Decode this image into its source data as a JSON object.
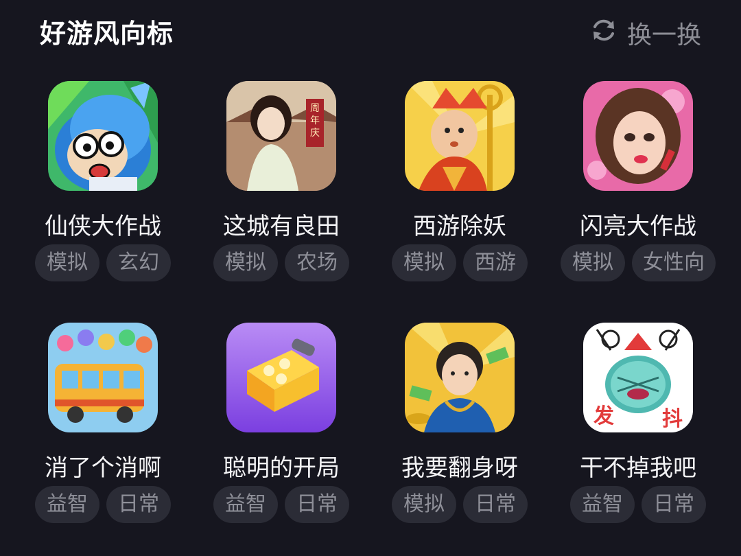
{
  "header": {
    "title": "好游风向标",
    "refresh_label": "换一换"
  },
  "games": [
    {
      "name": "仙侠大作战",
      "tags": [
        "模拟",
        "玄幻"
      ],
      "icon": "cartoon-swordsman-icon"
    },
    {
      "name": "这城有良田",
      "tags": [
        "模拟",
        "农场"
      ],
      "icon": "ancient-lady-icon",
      "banner_text": "周年庆"
    },
    {
      "name": "西游除妖",
      "tags": [
        "模拟",
        "西游"
      ],
      "icon": "monk-staff-icon"
    },
    {
      "name": "闪亮大作战",
      "tags": [
        "模拟",
        "女性向"
      ],
      "icon": "glam-girl-icon"
    },
    {
      "name": "消了个消啊",
      "tags": [
        "益智",
        "日常"
      ],
      "icon": "crowded-bus-icon"
    },
    {
      "name": "聪明的开局",
      "tags": [
        "益智",
        "日常"
      ],
      "icon": "yellow-box-icon"
    },
    {
      "name": "我要翻身呀",
      "tags": [
        "模拟",
        "日常"
      ],
      "icon": "young-man-money-icon"
    },
    {
      "name": "干不掉我吧",
      "tags": [
        "益智",
        "日常"
      ],
      "icon": "pineapple-monster-icon",
      "overlay_text": [
        "发",
        "抖"
      ]
    }
  ],
  "colors": {
    "background": "#16161f",
    "tag_bg": "#2b2c36",
    "tag_text": "#8e8f98",
    "title": "#ffffff"
  }
}
